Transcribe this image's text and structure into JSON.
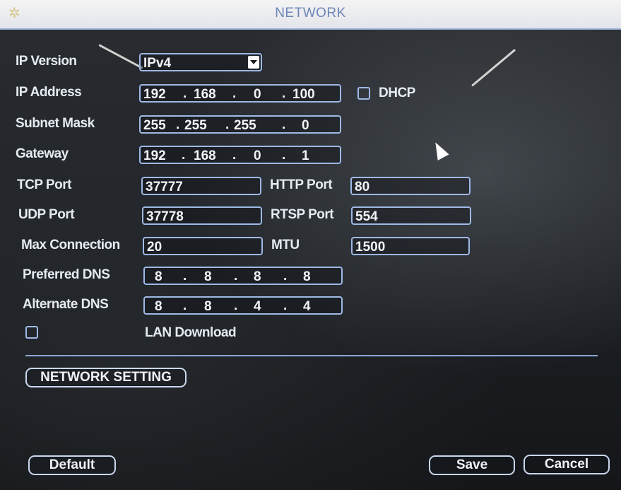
{
  "window": {
    "title": "NETWORK"
  },
  "fields": {
    "ip_version": {
      "label": "IP Version",
      "value": "IPv4"
    },
    "ip_address": {
      "label": "IP Address",
      "octets": [
        "192",
        "168",
        "0",
        "100"
      ]
    },
    "dhcp": {
      "label": "DHCP",
      "checked": false
    },
    "subnet_mask": {
      "label": "Subnet Mask",
      "octets": [
        "255",
        "255",
        "255",
        "0"
      ]
    },
    "gateway": {
      "label": "Gateway",
      "octets": [
        "192",
        "168",
        "0",
        "1"
      ]
    },
    "tcp_port": {
      "label": "TCP Port",
      "value": "37777"
    },
    "http_port": {
      "label": "HTTP Port",
      "value": "80"
    },
    "udp_port": {
      "label": "UDP Port",
      "value": "37778"
    },
    "rtsp_port": {
      "label": "RTSP Port",
      "value": "554"
    },
    "max_connection": {
      "label": "Max Connection",
      "value": "20"
    },
    "mtu": {
      "label": "MTU",
      "value": "1500"
    },
    "preferred_dns": {
      "label": "Preferred DNS",
      "octets": [
        "8",
        "8",
        "8",
        "8"
      ]
    },
    "alternate_dns": {
      "label": "Alternate DNS",
      "octets": [
        "8",
        "8",
        "4",
        "4"
      ]
    },
    "lan_download": {
      "label": "LAN Download",
      "checked": false
    }
  },
  "buttons": {
    "network_setting": "NETWORK SETTING",
    "default": "Default",
    "save": "Save",
    "cancel": "Cancel"
  },
  "ip_separator": ".",
  "colors": {
    "title_text": "#6d86b8",
    "field_border": "#9fb9e6",
    "label_text": "#e6ebf2"
  },
  "icons": [
    "dropdown-arrow-icon",
    "mouse-cursor-icon"
  ]
}
